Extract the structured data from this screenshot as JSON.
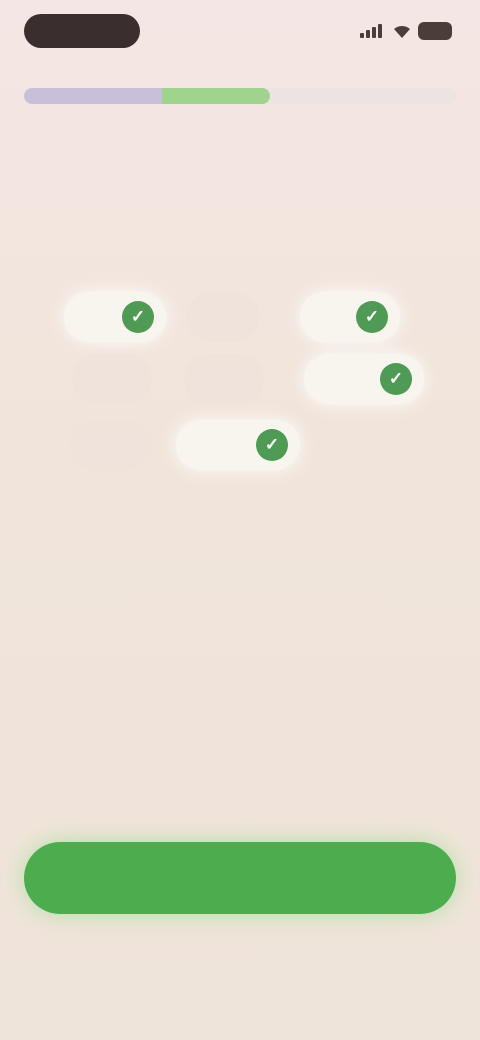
{
  "status_bar": {
    "time": "",
    "icons": [
      "signal-icon",
      "wifi-icon",
      "battery-icon"
    ]
  },
  "progress": {
    "completed_fraction": 0.32,
    "current_fraction": 0.25,
    "colors": {
      "done": "#c9bfd9",
      "current": "#9fd48f"
    }
  },
  "header": {
    "title": "",
    "subtitle": ""
  },
  "options": [
    {
      "label": "",
      "selected": true
    },
    {
      "label": "",
      "selected": false
    },
    {
      "label": "",
      "selected": true
    },
    {
      "label": "",
      "selected": false
    },
    {
      "label": "",
      "selected": false
    },
    {
      "label": "",
      "selected": true
    },
    {
      "label": "",
      "selected": false
    },
    {
      "label": "",
      "selected": true
    }
  ],
  "actions": {
    "continue_label": "",
    "skip_label": ""
  },
  "colors": {
    "accent": "#4cad4f",
    "check": "#4f9a54",
    "background": "#f1e5db"
  }
}
